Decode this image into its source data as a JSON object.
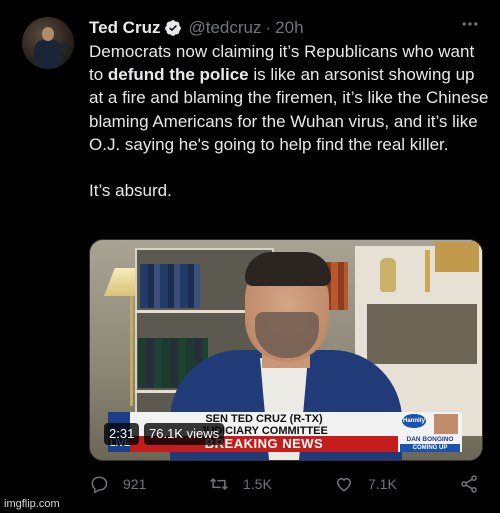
{
  "author": {
    "display_name": "Ted Cruz",
    "handle": "@tedcruz",
    "separator": "·",
    "time": "20h",
    "verified": true
  },
  "tweet": {
    "line1_pre": "Democrats now claiming it’s Republicans who want to ",
    "bold": "defund the police",
    "line1_post": " is like an arsonist showing up at a fire and blaming the firemen, it’s like the Chinese blaming Americans for the Wuhan virus, and it’s like O.J. saying he's going to help find the real killer.",
    "closing": "It’s absurd."
  },
  "media": {
    "duration": "2:31",
    "views": "76.1K views",
    "chyron_line1": "SEN TED CRUZ (R-TX)",
    "chyron_line2": "JUDICIARY COMMITTEE",
    "chyron_banner": "BREAKING NEWS",
    "live_label": "LIVE",
    "show_logo": "Hannity",
    "guest_name": "DAN BONGINO",
    "guest_sub": "COMING UP"
  },
  "actions": {
    "replies": "921",
    "retweets": "1.5K",
    "likes": "7.1K"
  },
  "icons": {
    "verified": "verified-badge-icon",
    "more": "more-icon",
    "reply": "reply-icon",
    "retweet": "retweet-icon",
    "like": "heart-icon",
    "share": "share-icon"
  },
  "colors": {
    "background": "#000000",
    "text": "#e7e9ea",
    "muted": "#71767b"
  },
  "watermark": "imgflip.com"
}
